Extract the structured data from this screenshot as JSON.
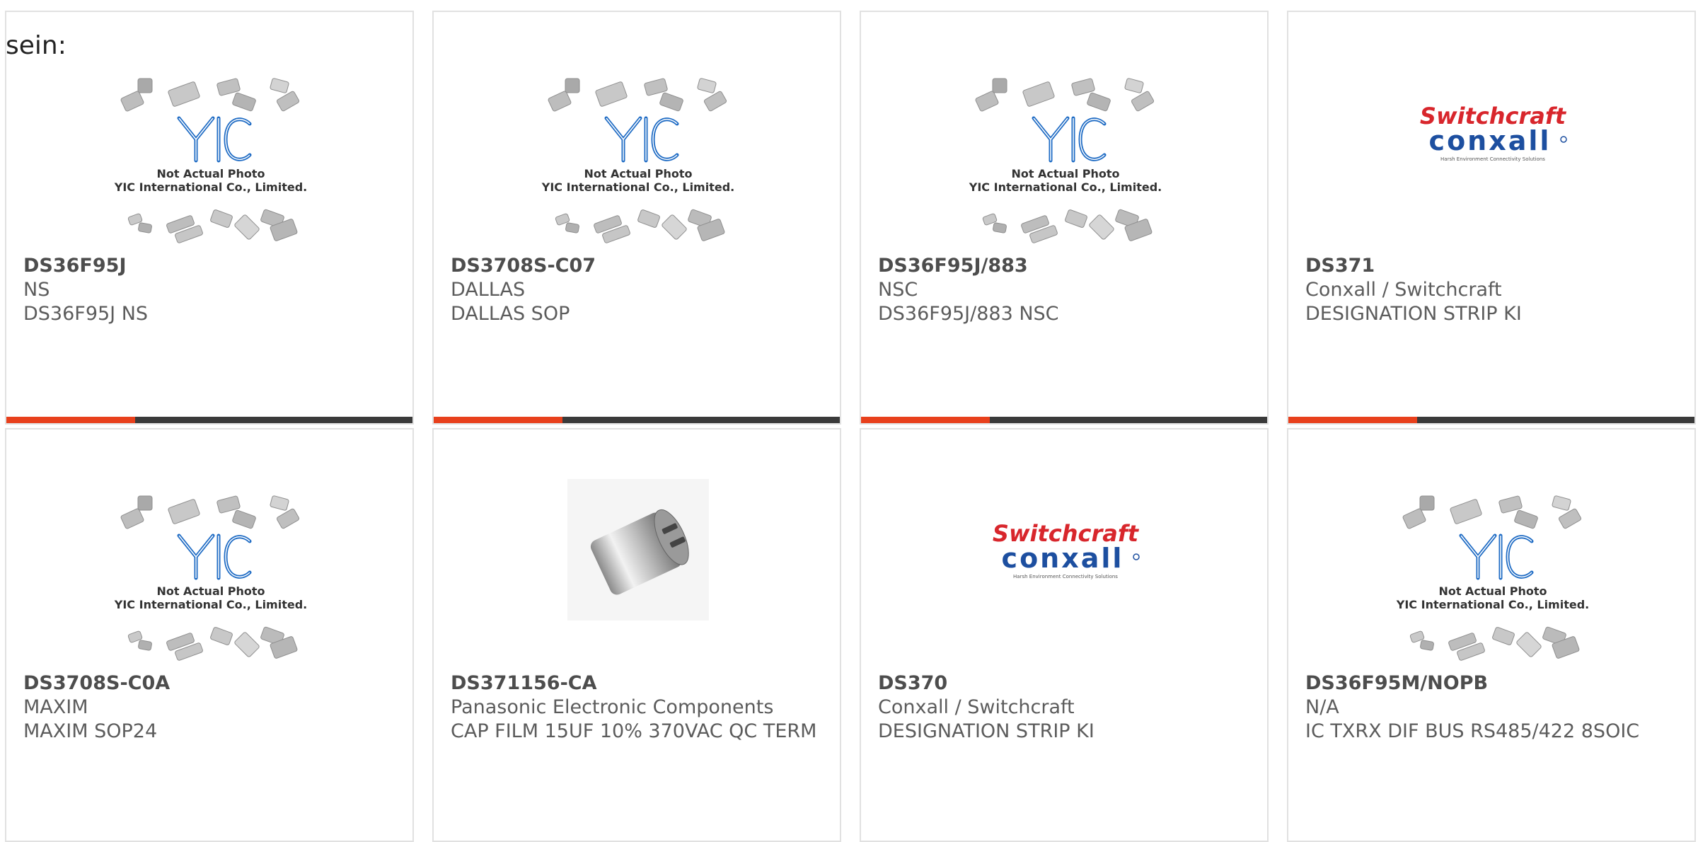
{
  "lead_text": "sein:",
  "colors": {
    "accent": "#e8401c",
    "bar": "#3a3a3a",
    "border": "#e1e1e1",
    "yic_blue": "#1e6bc4"
  },
  "placeholder": {
    "line1": "Not Actual Photo",
    "line2": "YIC International Co., Limited."
  },
  "brand": {
    "top": "Switchcraft",
    "bottom": "conxall",
    "tag": "Harsh Environment Connectivity Solutions"
  },
  "products": [
    {
      "part": "DS36F95J",
      "mfr": "NS",
      "desc": "DS36F95J NS",
      "image": "yic-placeholder",
      "bar": true
    },
    {
      "part": "DS3708S-C07",
      "mfr": "DALLAS",
      "desc": "DALLAS SOP",
      "image": "yic-placeholder",
      "bar": true
    },
    {
      "part": "DS36F95J/883",
      "mfr": "NSC",
      "desc": "DS36F95J/883 NSC",
      "image": "yic-placeholder",
      "bar": true
    },
    {
      "part": "DS371",
      "mfr": "Conxall / Switchcraft",
      "desc": "DESIGNATION STRIP KI",
      "image": "switchcraft-logo",
      "bar": true
    },
    {
      "part": "DS3708S-C0A",
      "mfr": "MAXIM",
      "desc": "MAXIM SOP24",
      "image": "yic-placeholder",
      "bar": false
    },
    {
      "part": "DS371156-CA",
      "mfr": "Panasonic Electronic Components",
      "desc": "CAP FILM 15UF 10% 370VAC QC TERM",
      "image": "capacitor-photo",
      "bar": false
    },
    {
      "part": "DS370",
      "mfr": "Conxall / Switchcraft",
      "desc": "DESIGNATION STRIP KI",
      "image": "switchcraft-logo",
      "bar": false
    },
    {
      "part": "DS36F95M/NOPB",
      "mfr": "N/A",
      "desc": "IC TXRX DIF BUS RS485/422 8SOIC",
      "image": "yic-placeholder",
      "bar": false
    }
  ]
}
